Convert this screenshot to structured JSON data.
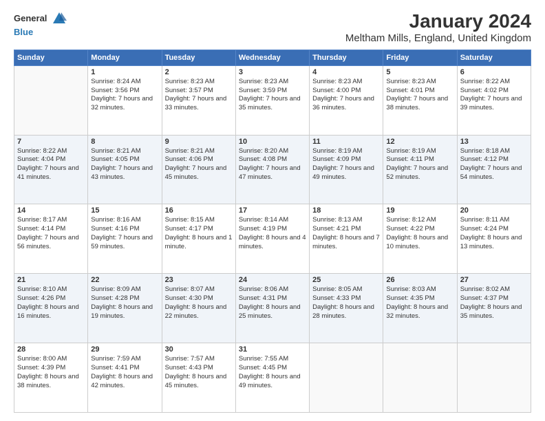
{
  "logo": {
    "general": "General",
    "blue": "Blue"
  },
  "title": "January 2024",
  "subtitle": "Meltham Mills, England, United Kingdom",
  "days_header": [
    "Sunday",
    "Monday",
    "Tuesday",
    "Wednesday",
    "Thursday",
    "Friday",
    "Saturday"
  ],
  "weeks": [
    [
      {
        "day": "",
        "sunrise": "",
        "sunset": "",
        "daylight": ""
      },
      {
        "day": "1",
        "sunrise": "Sunrise: 8:24 AM",
        "sunset": "Sunset: 3:56 PM",
        "daylight": "Daylight: 7 hours and 32 minutes."
      },
      {
        "day": "2",
        "sunrise": "Sunrise: 8:23 AM",
        "sunset": "Sunset: 3:57 PM",
        "daylight": "Daylight: 7 hours and 33 minutes."
      },
      {
        "day": "3",
        "sunrise": "Sunrise: 8:23 AM",
        "sunset": "Sunset: 3:59 PM",
        "daylight": "Daylight: 7 hours and 35 minutes."
      },
      {
        "day": "4",
        "sunrise": "Sunrise: 8:23 AM",
        "sunset": "Sunset: 4:00 PM",
        "daylight": "Daylight: 7 hours and 36 minutes."
      },
      {
        "day": "5",
        "sunrise": "Sunrise: 8:23 AM",
        "sunset": "Sunset: 4:01 PM",
        "daylight": "Daylight: 7 hours and 38 minutes."
      },
      {
        "day": "6",
        "sunrise": "Sunrise: 8:22 AM",
        "sunset": "Sunset: 4:02 PM",
        "daylight": "Daylight: 7 hours and 39 minutes."
      }
    ],
    [
      {
        "day": "7",
        "sunrise": "Sunrise: 8:22 AM",
        "sunset": "Sunset: 4:04 PM",
        "daylight": "Daylight: 7 hours and 41 minutes."
      },
      {
        "day": "8",
        "sunrise": "Sunrise: 8:21 AM",
        "sunset": "Sunset: 4:05 PM",
        "daylight": "Daylight: 7 hours and 43 minutes."
      },
      {
        "day": "9",
        "sunrise": "Sunrise: 8:21 AM",
        "sunset": "Sunset: 4:06 PM",
        "daylight": "Daylight: 7 hours and 45 minutes."
      },
      {
        "day": "10",
        "sunrise": "Sunrise: 8:20 AM",
        "sunset": "Sunset: 4:08 PM",
        "daylight": "Daylight: 7 hours and 47 minutes."
      },
      {
        "day": "11",
        "sunrise": "Sunrise: 8:19 AM",
        "sunset": "Sunset: 4:09 PM",
        "daylight": "Daylight: 7 hours and 49 minutes."
      },
      {
        "day": "12",
        "sunrise": "Sunrise: 8:19 AM",
        "sunset": "Sunset: 4:11 PM",
        "daylight": "Daylight: 7 hours and 52 minutes."
      },
      {
        "day": "13",
        "sunrise": "Sunrise: 8:18 AM",
        "sunset": "Sunset: 4:12 PM",
        "daylight": "Daylight: 7 hours and 54 minutes."
      }
    ],
    [
      {
        "day": "14",
        "sunrise": "Sunrise: 8:17 AM",
        "sunset": "Sunset: 4:14 PM",
        "daylight": "Daylight: 7 hours and 56 minutes."
      },
      {
        "day": "15",
        "sunrise": "Sunrise: 8:16 AM",
        "sunset": "Sunset: 4:16 PM",
        "daylight": "Daylight: 7 hours and 59 minutes."
      },
      {
        "day": "16",
        "sunrise": "Sunrise: 8:15 AM",
        "sunset": "Sunset: 4:17 PM",
        "daylight": "Daylight: 8 hours and 1 minute."
      },
      {
        "day": "17",
        "sunrise": "Sunrise: 8:14 AM",
        "sunset": "Sunset: 4:19 PM",
        "daylight": "Daylight: 8 hours and 4 minutes."
      },
      {
        "day": "18",
        "sunrise": "Sunrise: 8:13 AM",
        "sunset": "Sunset: 4:21 PM",
        "daylight": "Daylight: 8 hours and 7 minutes."
      },
      {
        "day": "19",
        "sunrise": "Sunrise: 8:12 AM",
        "sunset": "Sunset: 4:22 PM",
        "daylight": "Daylight: 8 hours and 10 minutes."
      },
      {
        "day": "20",
        "sunrise": "Sunrise: 8:11 AM",
        "sunset": "Sunset: 4:24 PM",
        "daylight": "Daylight: 8 hours and 13 minutes."
      }
    ],
    [
      {
        "day": "21",
        "sunrise": "Sunrise: 8:10 AM",
        "sunset": "Sunset: 4:26 PM",
        "daylight": "Daylight: 8 hours and 16 minutes."
      },
      {
        "day": "22",
        "sunrise": "Sunrise: 8:09 AM",
        "sunset": "Sunset: 4:28 PM",
        "daylight": "Daylight: 8 hours and 19 minutes."
      },
      {
        "day": "23",
        "sunrise": "Sunrise: 8:07 AM",
        "sunset": "Sunset: 4:30 PM",
        "daylight": "Daylight: 8 hours and 22 minutes."
      },
      {
        "day": "24",
        "sunrise": "Sunrise: 8:06 AM",
        "sunset": "Sunset: 4:31 PM",
        "daylight": "Daylight: 8 hours and 25 minutes."
      },
      {
        "day": "25",
        "sunrise": "Sunrise: 8:05 AM",
        "sunset": "Sunset: 4:33 PM",
        "daylight": "Daylight: 8 hours and 28 minutes."
      },
      {
        "day": "26",
        "sunrise": "Sunrise: 8:03 AM",
        "sunset": "Sunset: 4:35 PM",
        "daylight": "Daylight: 8 hours and 32 minutes."
      },
      {
        "day": "27",
        "sunrise": "Sunrise: 8:02 AM",
        "sunset": "Sunset: 4:37 PM",
        "daylight": "Daylight: 8 hours and 35 minutes."
      }
    ],
    [
      {
        "day": "28",
        "sunrise": "Sunrise: 8:00 AM",
        "sunset": "Sunset: 4:39 PM",
        "daylight": "Daylight: 8 hours and 38 minutes."
      },
      {
        "day": "29",
        "sunrise": "Sunrise: 7:59 AM",
        "sunset": "Sunset: 4:41 PM",
        "daylight": "Daylight: 8 hours and 42 minutes."
      },
      {
        "day": "30",
        "sunrise": "Sunrise: 7:57 AM",
        "sunset": "Sunset: 4:43 PM",
        "daylight": "Daylight: 8 hours and 45 minutes."
      },
      {
        "day": "31",
        "sunrise": "Sunrise: 7:55 AM",
        "sunset": "Sunset: 4:45 PM",
        "daylight": "Daylight: 8 hours and 49 minutes."
      },
      {
        "day": "",
        "sunrise": "",
        "sunset": "",
        "daylight": ""
      },
      {
        "day": "",
        "sunrise": "",
        "sunset": "",
        "daylight": ""
      },
      {
        "day": "",
        "sunrise": "",
        "sunset": "",
        "daylight": ""
      }
    ]
  ]
}
